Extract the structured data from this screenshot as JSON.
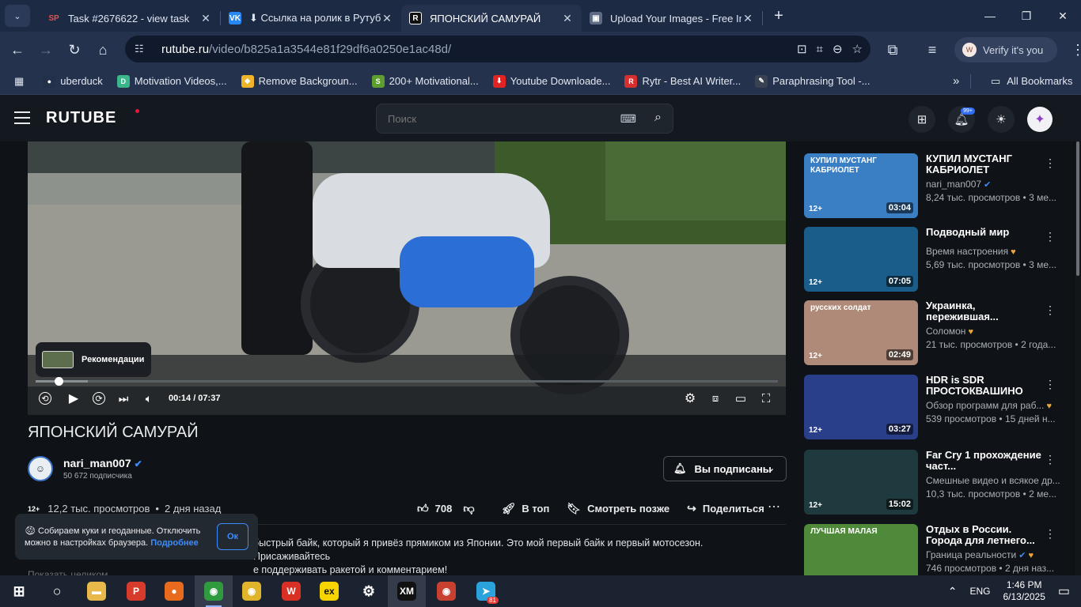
{
  "browser": {
    "tabs": [
      {
        "title": "Task #2676622 - view task",
        "icon": "sp-icon",
        "color": "#c0392b",
        "glyph": "SP"
      },
      {
        "title": "⬇ Ссылка на ролик в Рутуб ⬇ h",
        "icon": "vk-icon",
        "color": "#2787f5",
        "glyph": "VK"
      },
      {
        "title": "ЯПОНСКИЙ САМУРАЙ",
        "icon": "rutube-icon",
        "color": "#111111",
        "glyph": "R"
      },
      {
        "title": "Upload Your Images - Free Imag",
        "icon": "upload-icon",
        "color": "#2f3a4d",
        "glyph": "⬛"
      }
    ],
    "url_host": "rutube.ru",
    "url_path": "/video/b825a1a3544e81f29df6a0250e1ac48d/",
    "verify_label": "Verify it's you",
    "bookmarks": [
      {
        "label": "uberduck",
        "color": "#223049",
        "glyph": "●"
      },
      {
        "label": "Motivation Videos,...",
        "color": "#3bb58a",
        "glyph": "D"
      },
      {
        "label": "Remove Backgroun...",
        "color": "#f0b429",
        "glyph": "◆"
      },
      {
        "label": "200+ Motivational...",
        "color": "#5e9e2e",
        "glyph": "S"
      },
      {
        "label": "Youtube Downloade...",
        "color": "#e02424",
        "glyph": "⬇"
      },
      {
        "label": "Rytr - Best AI Writer...",
        "color": "#d62f2f",
        "glyph": "R"
      },
      {
        "label": "Paraphrasing Tool -...",
        "color": "#3a4150",
        "glyph": "✎"
      }
    ],
    "all_bookmarks_label": "All Bookmarks"
  },
  "header": {
    "logo": "RUTUBE",
    "search_placeholder": "Поиск",
    "notif_badge": "99+"
  },
  "player": {
    "reco_label": "Рекомендации",
    "time": "00:14 / 07:37",
    "progress": 0.031,
    "buffered": 0.07
  },
  "video": {
    "title": "ЯПОНСКИЙ САМУРАЙ",
    "channel_name": "nari_man007",
    "subscribers": "50 672 подписчика",
    "subscribe_label": "Вы подписаны",
    "age": "12+",
    "views": "12,2 тыс. просмотров",
    "posted": "2 дня назад",
    "likes": "708",
    "top_label": "В топ",
    "watch_later_label": "Смотреть позже",
    "share_label": "Поделиться",
    "desc_line1": "быстрый байк, который я привёз прямиком из Японии. Это мой первый байк и первый мотосезон. Присаживайтесь",
    "desc_line2": "е поддерживать ракетой и комментарием!",
    "show_full": "Показать целиком ⌄"
  },
  "cookie": {
    "text": "Собираем куки и геоданные. Отключить можно в настройках браузера.",
    "link": "Подробнее",
    "ok": "Ок"
  },
  "recommendations": [
    {
      "title": "КУПИЛ МУСТАНГ КАБРИОЛЕТ",
      "channel": "nari_man007",
      "verified": true,
      "heart": false,
      "stats": "8,24 тыс. просмотров • 3 ме...",
      "age": "12+",
      "duration": "03:04",
      "thumb_color": "#3a7fc4",
      "thumb_text": "КУПИЛ МУСТАНГ КАБРИОЛЕТ"
    },
    {
      "title": "Подводный мир",
      "channel": "Время настроения",
      "verified": false,
      "heart": true,
      "stats": "5,69 тыс. просмотров • 3 ме...",
      "age": "12+",
      "duration": "07:05",
      "thumb_color": "#1b5d8a",
      "thumb_text": ""
    },
    {
      "title": "Украинка, пережившая...",
      "channel": "Соломон",
      "verified": false,
      "heart": true,
      "stats": "21 тыс. просмотров • 2 года...",
      "age": "12+",
      "duration": "02:49",
      "thumb_color": "#b08a78",
      "thumb_text": "русских солдат"
    },
    {
      "title": "HDR is SDR ПРОСТОКВАШИНО",
      "channel": "Обзор программ для раб...",
      "verified": false,
      "heart": true,
      "stats": "539 просмотров • 15 дней н...",
      "age": "12+",
      "duration": "03:27",
      "thumb_color": "#2a3f8a",
      "thumb_text": ""
    },
    {
      "title": "Far Cry 1 прохождение част...",
      "channel": "Смешные видео и всякое др...",
      "verified": false,
      "heart": false,
      "stats": "10,3 тыс. просмотров • 2 ме...",
      "age": "12+",
      "duration": "15:02",
      "thumb_color": "#1f3a3f",
      "thumb_text": ""
    },
    {
      "title": "Отдых в России. Города для летнего...",
      "channel": "Граница реальности",
      "verified": true,
      "heart": true,
      "stats": "746 просмотров • 2 дня наз...",
      "age": "",
      "duration": "",
      "thumb_color": "#4f8a3a",
      "thumb_text": "ЛУЧШАЯ МАЛАЯ"
    }
  ],
  "taskbar": {
    "apps": [
      {
        "name": "windows-start-icon",
        "glyph": "⊞",
        "color": "transparent"
      },
      {
        "name": "cortana-search-icon",
        "glyph": "○",
        "color": "transparent"
      },
      {
        "name": "file-explorer-icon",
        "glyph": "▬",
        "color": "#e8b94a"
      },
      {
        "name": "rutube-app-icon",
        "glyph": "Р",
        "color": "#d63b2b"
      },
      {
        "name": "firefox-icon",
        "glyph": "●",
        "color": "#e86a1d"
      },
      {
        "name": "chrome-profile-icon",
        "glyph": "◉",
        "color": "#2f9a3e"
      },
      {
        "name": "chrome-icon",
        "glyph": "◉",
        "color": "#e0b52b"
      },
      {
        "name": "wps-office-icon",
        "glyph": "W",
        "color": "#d93025"
      },
      {
        "name": "exness-icon",
        "glyph": "ex",
        "color": "#f5d400"
      },
      {
        "name": "settings-icon",
        "glyph": "⚙",
        "color": "transparent"
      },
      {
        "name": "xm-icon",
        "glyph": "XM",
        "color": "#111111"
      },
      {
        "name": "chrome-alt-icon",
        "glyph": "◉",
        "color": "#c8402f"
      },
      {
        "name": "telegram-icon",
        "glyph": "➤",
        "color": "#2aa3dd"
      }
    ],
    "telegram_badge": "81",
    "lang": "ENG",
    "time": "1:46 PM",
    "date": "6/13/2025"
  }
}
